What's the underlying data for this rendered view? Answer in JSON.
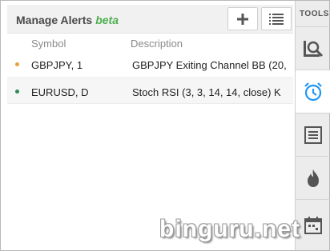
{
  "panel": {
    "title": "Manage Alerts",
    "beta": "beta",
    "add_icon": "plus-icon",
    "list_icon": "list-icon"
  },
  "table": {
    "columns": [
      "Symbol",
      "Description"
    ],
    "rows": [
      {
        "symbol": "GBPJPY, 1",
        "description": "GBPJPY Exiting Channel BB (20,",
        "status_color": "#e6a23c"
      },
      {
        "symbol": "EURUSD, D",
        "description": "Stoch RSI (3, 3, 14, 14, close) K",
        "status_color": "#2e8b57"
      }
    ]
  },
  "tools": {
    "label": "TOOLS",
    "items": [
      "search-chart-icon",
      "alarm-clock-icon",
      "list-panel-icon",
      "fire-icon",
      "calendar-icon"
    ],
    "active_color": "#2196f3"
  },
  "watermark": "binguru.net"
}
